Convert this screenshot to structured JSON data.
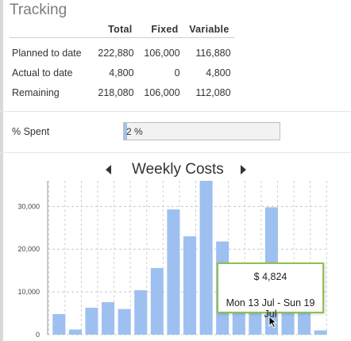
{
  "tracking": {
    "title": "Tracking",
    "columns": [
      "Total",
      "Fixed",
      "Variable"
    ],
    "rows": [
      {
        "label": "Planned to date",
        "total": "222,880",
        "fixed": "106,000",
        "variable": "116,880"
      },
      {
        "label": "Actual to date",
        "total": "4,800",
        "fixed": "0",
        "variable": "4,800"
      },
      {
        "label": "Remaining",
        "total": "218,080",
        "fixed": "106,000",
        "variable": "112,080"
      }
    ]
  },
  "spent": {
    "label": "% Spent",
    "text": "2 %",
    "fraction": 0.02
  },
  "chart": {
    "title": "Weekly Costs",
    "tooltip_amount": "$ 4,824",
    "tooltip_range": "Mon 13 Jul - Sun 19 Jul"
  },
  "chart_data": {
    "type": "bar",
    "title": "Weekly Costs",
    "xlabel": "",
    "ylabel": "",
    "ylim": [
      0,
      36000
    ],
    "yticks": [
      0,
      10000,
      20000,
      30000
    ],
    "ytick_labels": [
      "0",
      "10,000",
      "20,000",
      "30,000"
    ],
    "grid": true,
    "values": [
      4824,
      1200,
      6300,
      7600,
      6000,
      10400,
      15600,
      29300,
      23000,
      36500,
      21800,
      7000,
      6500,
      29800,
      5000,
      6000,
      1000
    ],
    "color": "#9ec0f0"
  },
  "colors": {
    "bar": "#9ec0f0",
    "accent_border": "#8fc14f",
    "progress_fill": "#9fc3ec"
  }
}
